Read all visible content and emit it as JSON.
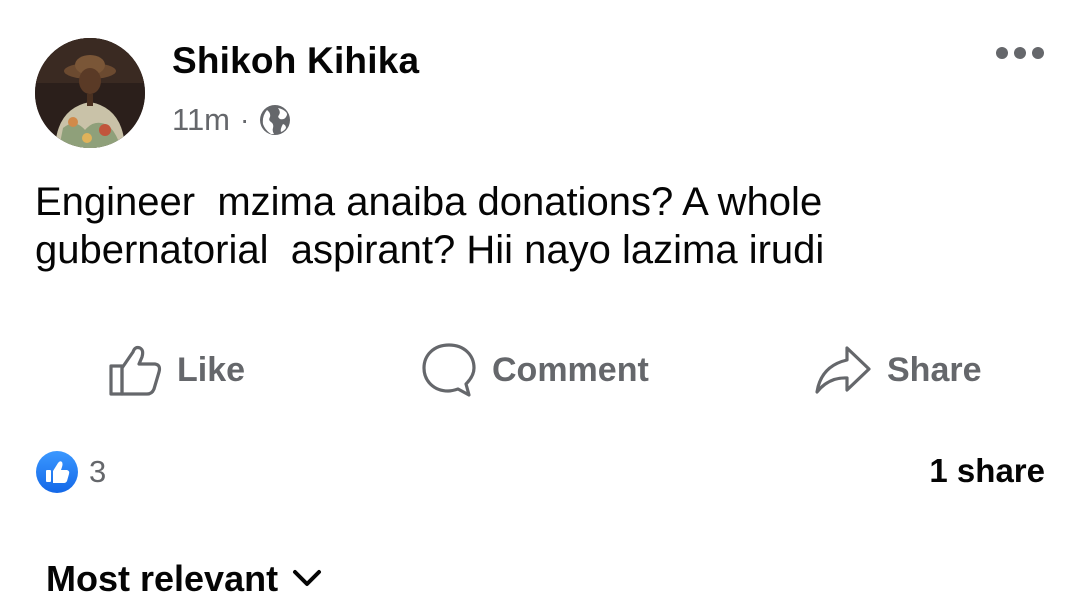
{
  "post": {
    "author": "Shikoh Kihika",
    "time": "11m",
    "separator": "·",
    "audience_icon": "globe-icon",
    "more_icon": "more-options-icon",
    "text": "Engineer  mzima anaiba donations? A whole\ngubernatorial  aspirant? Hii nayo lazima irudi"
  },
  "actions": {
    "like_label": "Like",
    "comment_label": "Comment",
    "share_label": "Share"
  },
  "stats": {
    "reaction_icon": "like-reaction-icon",
    "reaction_count": "3",
    "share_count": "1 share"
  },
  "comments": {
    "sort_label": "Most relevant",
    "sort_icon": "chevron-down-icon"
  },
  "colors": {
    "primary_text": "#050505",
    "secondary_text": "#65676b",
    "like_blue": "#1877f2"
  }
}
